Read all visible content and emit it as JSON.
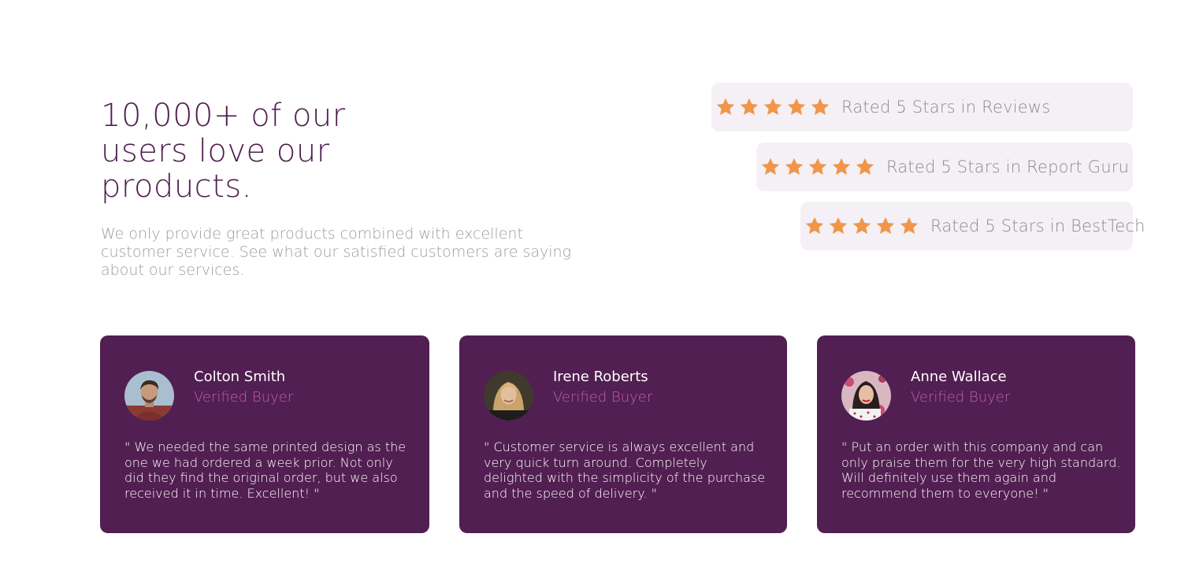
{
  "hero": {
    "headline": "10,000+ of our users love our products.",
    "subtext": "We only provide great products combined with excellent customer service. See what our satisfied customers are saying about our services."
  },
  "ratings": [
    {
      "label": "Rated 5 Stars in Reviews",
      "stars": 5
    },
    {
      "label": "Rated 5 Stars in Report Guru",
      "stars": 5
    },
    {
      "label": "Rated 5 Stars in BestTech",
      "stars": 5
    }
  ],
  "testimonials": [
    {
      "name": "Colton Smith",
      "role": "Verified Buyer",
      "quote": "\" We needed the same printed design as the one we had ordered a week prior. Not only did they find the original order, but we also received it in time. Excellent! \"",
      "avatar_icon": "person-avatar-icon"
    },
    {
      "name": "Irene Roberts",
      "role": "Verified Buyer",
      "quote": "\" Customer service is always excellent and very quick turn around. Completely delighted with the simplicity of the purchase and the speed of delivery. \"",
      "avatar_icon": "person-avatar-icon"
    },
    {
      "name": "Anne Wallace",
      "role": "Verified Buyer",
      "quote": "\" Put an order with this company and can only praise them for the very high standard. Will definitely use them again and recommend them to everyone! \"",
      "avatar_icon": "person-avatar-icon"
    }
  ],
  "colors": {
    "card_bg": "#511f51",
    "accent_pink": "#c45bb4",
    "star": "#f0964a",
    "pill_bg": "#f5f0f6",
    "headline": "#4f1e50"
  }
}
